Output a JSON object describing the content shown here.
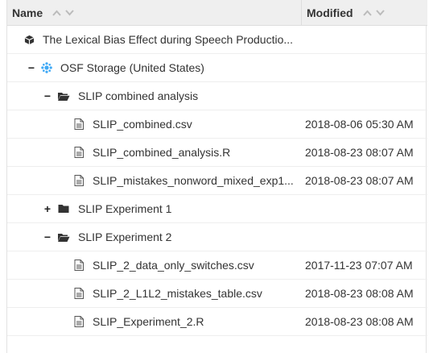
{
  "header": {
    "name_label": "Name",
    "modified_label": "Modified"
  },
  "rows": [
    {
      "label": "The Lexical Bias Effect during Speech Productio...",
      "modified": "",
      "icon": "project-cube-icon",
      "toggle": ""
    },
    {
      "label": "OSF Storage (United States)",
      "modified": "",
      "icon": "osf-storage-icon",
      "toggle": "−"
    },
    {
      "label": "SLIP combined analysis",
      "modified": "",
      "icon": "folder-open-icon",
      "toggle": "−"
    },
    {
      "label": "SLIP_combined.csv",
      "modified": "2018-08-06 05:30 AM",
      "icon": "file-icon",
      "toggle": ""
    },
    {
      "label": "SLIP_combined_analysis.R",
      "modified": "2018-08-23 08:07 AM",
      "icon": "file-icon",
      "toggle": ""
    },
    {
      "label": "SLIP_mistakes_nonword_mixed_exp1...",
      "modified": "2018-08-23 08:07 AM",
      "icon": "file-icon",
      "toggle": ""
    },
    {
      "label": "SLIP Experiment 1",
      "modified": "",
      "icon": "folder-closed-icon",
      "toggle": "+"
    },
    {
      "label": "SLIP Experiment 2",
      "modified": "",
      "icon": "folder-open-icon",
      "toggle": "−"
    },
    {
      "label": "SLIP_2_data_only_switches.csv",
      "modified": "2017-11-23 07:07 AM",
      "icon": "file-icon",
      "toggle": ""
    },
    {
      "label": "SLIP_2_L1L2_mistakes_table.csv",
      "modified": "2018-08-23 08:08 AM",
      "icon": "file-icon",
      "toggle": ""
    },
    {
      "label": "SLIP_Experiment_2.R",
      "modified": "2018-08-23 08:08 AM",
      "icon": "file-icon",
      "toggle": ""
    }
  ],
  "colors": {
    "header_bg": "#efefef",
    "osf_storage_icon": "#3fa9f5",
    "text": "#333333"
  }
}
